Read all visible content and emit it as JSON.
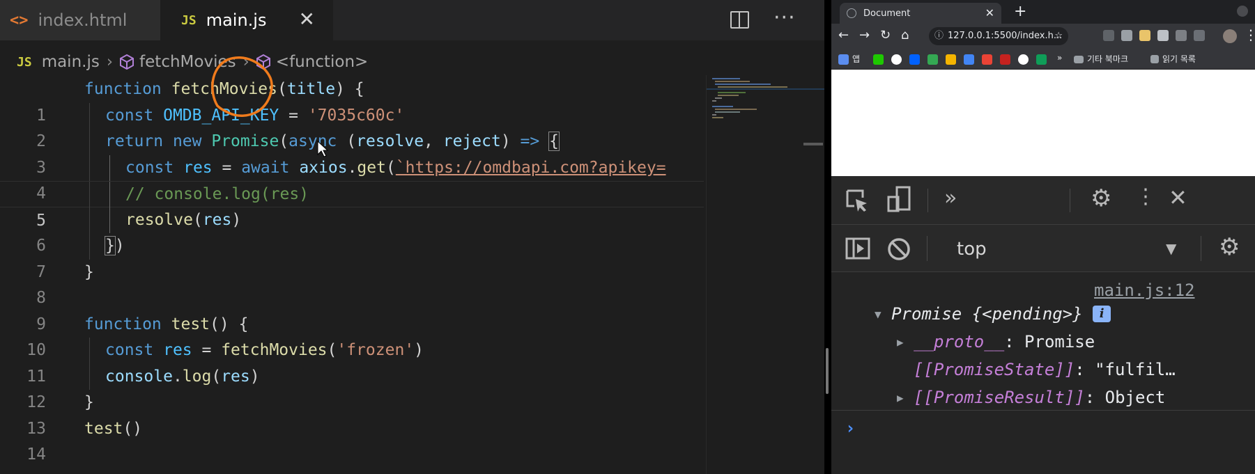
{
  "editor": {
    "tabs": [
      {
        "icon": "html-file-icon",
        "label": "index.html"
      },
      {
        "icon": "js-file-icon",
        "label": "main.js"
      }
    ],
    "tab_close": "✕",
    "more": "···",
    "breadcrumb": {
      "file_icon": "JS",
      "file": "main.js",
      "symbol1": "fetchMovies",
      "symbol2": "<function>"
    },
    "active_line": 5,
    "line_numbers": [
      "1",
      "2",
      "3",
      "4",
      "5",
      "6",
      "7",
      "8",
      "9",
      "10",
      "11",
      "12",
      "13",
      "14"
    ]
  },
  "code": {
    "l1": {
      "kw": "function",
      "fn": "fetchMovies",
      "open": "(",
      "param": "title",
      "close": ") {"
    },
    "l2": {
      "kw": "const",
      "name": "OMDB_API_KEY",
      "eq": " = ",
      "str": "'7035c60c'"
    },
    "l3": {
      "kw": "return",
      "kw2": "new",
      "cls": "Promise",
      "p1": "(",
      "kw3": "async",
      "p2": " (",
      "a1": "resolve",
      "c": ", ",
      "a2": "reject",
      "p3": ") ",
      "arrow": "=>",
      "brace": "{"
    },
    "l4": {
      "kw": "const",
      "name": "res",
      "eq": " = ",
      "kw2": "await",
      "obj": "axios",
      "dot": ".",
      "fn": "get",
      "p": "(",
      "url": "`https://omdbapi.com?apikey="
    },
    "l5": {
      "comment": "// console.log(res)"
    },
    "l6": {
      "fn": "resolve",
      "p1": "(",
      "arg": "res",
      "p2": ")"
    },
    "l7": {
      "brace": "}",
      "p": ")"
    },
    "l8": {
      "brace": "}"
    },
    "l10": {
      "kw": "function",
      "fn": "test",
      "rest": "() {"
    },
    "l11": {
      "kw": "const",
      "name": "res",
      "eq": " = ",
      "fn": "fetchMovies",
      "p1": "(",
      "str": "'frozen'",
      "p2": ")"
    },
    "l12": {
      "obj": "console",
      "dot": ".",
      "fn": "log",
      "p1": "(",
      "arg": "res",
      "p2": ")"
    },
    "l13": {
      "brace": "}"
    },
    "l14": {
      "fn": "test",
      "p": "()"
    }
  },
  "browser": {
    "tab_title": "Document",
    "tab_close": "✕",
    "new_tab": "+",
    "url": "127.0.0.1:5500/index.h...",
    "bookmarks_other": "기타 북마크",
    "reading_list": "읽기 목록",
    "bookmark_first": "앱"
  },
  "devtools": {
    "context": "top",
    "source_link": "main.js:12",
    "object_label": "Promise",
    "object_summary": "{<pending>}",
    "info_badge": "i",
    "proto_key": "__proto__",
    "proto_value": ": Promise",
    "state_key": "[[PromiseState]]",
    "state_value": ": \"fulfil…",
    "result_key": "[[PromiseResult]]",
    "result_value": ": Object",
    "prompt": "›"
  },
  "colors": {
    "editor_bg": "#1e1e1e",
    "keyword": "#569cd6",
    "function": "#dcdcaa",
    "string": "#ce9178",
    "comment": "#6a9955",
    "annotation": "#f07b1c",
    "console_purple": "#c57fd8"
  }
}
